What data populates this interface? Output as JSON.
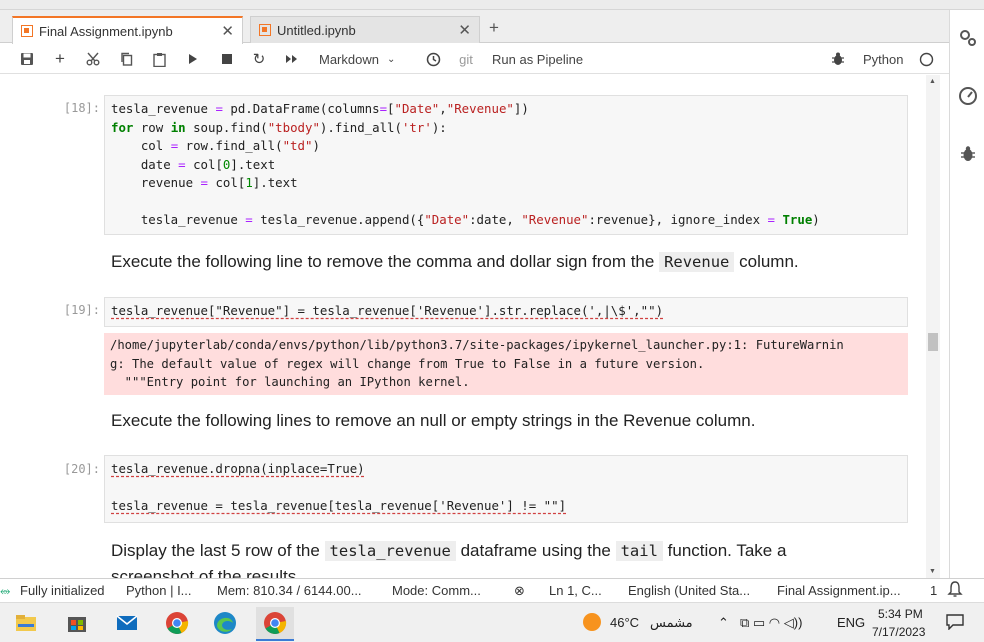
{
  "tabs": [
    {
      "label": "Final Assignment.ipynb",
      "active": true
    },
    {
      "label": "Untitled.ipynb",
      "active": false
    }
  ],
  "toolbar": {
    "cell_type": "Markdown",
    "git_label": "git",
    "pipeline_label": "Run as Pipeline",
    "kernel": "Python"
  },
  "cells": {
    "c18": {
      "prompt": "[18]:",
      "lines": [
        "tesla_revenue = pd.DataFrame(columns=[\"Date\",\"Revenue\"])",
        "for row in soup.find(\"tbody\").find_all('tr'):",
        "    col = row.find_all(\"td\")",
        "    date = col[0].text",
        "    revenue = col[1].text",
        "",
        "    tesla_revenue = tesla_revenue.append({\"Date\":date, \"Revenue\":revenue}, ignore_index = True)"
      ]
    },
    "md1": {
      "before": "Execute the following line to remove the comma and dollar sign from the ",
      "code": "Revenue",
      "after": " column."
    },
    "c19": {
      "prompt": "[19]:",
      "code": "tesla_revenue[\"Revenue\"] = tesla_revenue['Revenue'].str.replace(',|\\$',\"\")",
      "warning": [
        "/home/jupyterlab/conda/envs/python/lib/python3.7/site-packages/ipykernel_launcher.py:1: FutureWarnin",
        "g: The default value of regex will change from True to False in a future version.",
        "  \"\"\"Entry point for launching an IPython kernel."
      ]
    },
    "md2": {
      "text": "Execute the following lines to remove an null or empty strings in the Revenue column."
    },
    "c20": {
      "prompt": "[20]:",
      "line1": "tesla_revenue.dropna(inplace=True)",
      "line2": "tesla_revenue = tesla_revenue[tesla_revenue['Revenue'] != \"\"]"
    },
    "md3": {
      "p1": "Display the last 5 row of the ",
      "code1": "tesla_revenue",
      "p2": " dataframe using the ",
      "code2": "tail",
      "p3": " function. Take a",
      "line2": "screenshot of the results."
    }
  },
  "statusbar": {
    "init": "Fully initialized",
    "kernel": "Python | I...",
    "mem": "Mem: 810.34 / 6144.00...",
    "mode": "Mode: Comm...",
    "position": "Ln 1, C...",
    "language": "English (United Sta...",
    "file": "Final Assignment.ip...",
    "count": "1"
  },
  "taskbar": {
    "temp": "46°C",
    "weather": "مشمس",
    "lang": "ENG",
    "time": "5:34 PM",
    "date": "7/17/2023"
  }
}
